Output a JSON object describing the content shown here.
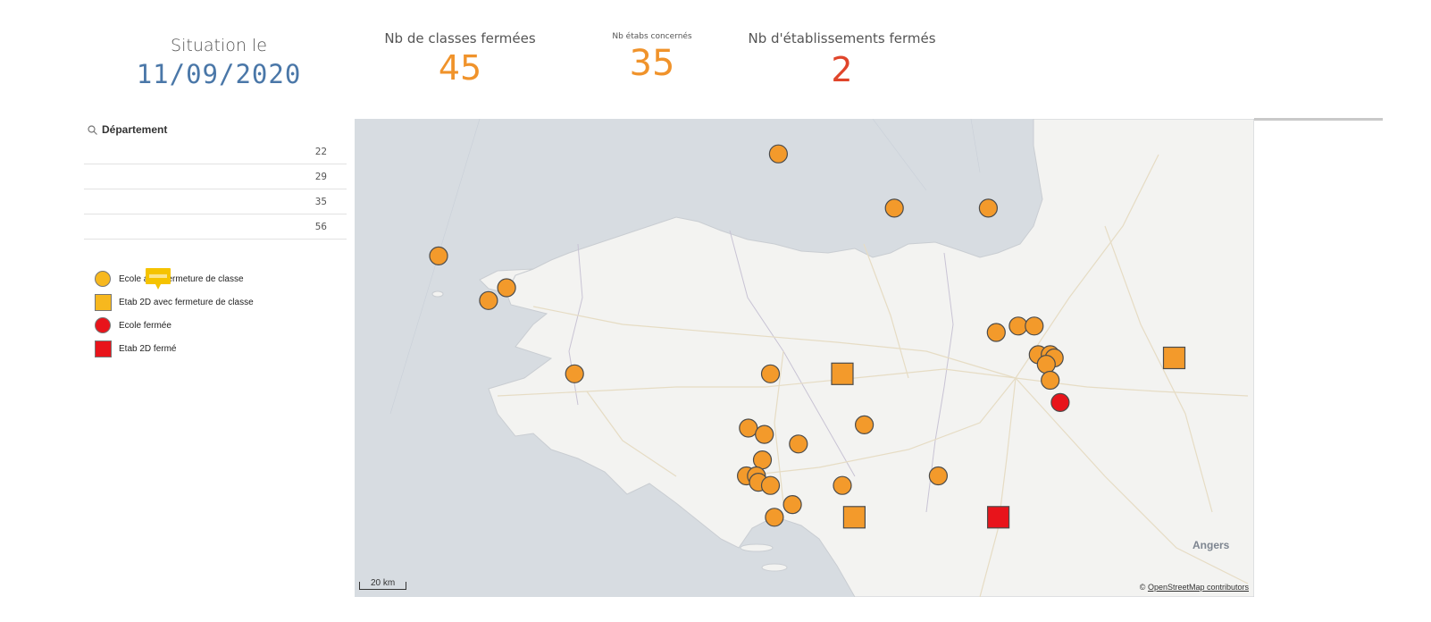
{
  "kpis": {
    "date": {
      "label": "Situation le",
      "value": "11/09/2020"
    },
    "classes": {
      "label": "Nb de classes fermées",
      "value": "45"
    },
    "etabs": {
      "label": "Nb étabs concernés",
      "value": "35"
    },
    "closed": {
      "label": "Nb d'établissements fermés",
      "value": "2"
    }
  },
  "filter": {
    "title": "Département",
    "icon": "search-icon",
    "rows": [
      "22",
      "29",
      "35",
      "56"
    ]
  },
  "legend": {
    "items": [
      {
        "label": "Ecole avec fermeture de classe",
        "shape": "circle",
        "color": "#f7b81e"
      },
      {
        "label": "Etab 2D avec fermeture de classe",
        "shape": "square",
        "color": "#f7b81e"
      },
      {
        "label": "Ecole fermée",
        "shape": "circle",
        "color": "#e8141b"
      },
      {
        "label": "Etab 2D fermé",
        "shape": "square",
        "color": "#e8141b"
      }
    ],
    "comment_icon": "comment-icon"
  },
  "map": {
    "scale_label": "20 km",
    "attribution_prefix": "© ",
    "attribution_link": "OpenStreetMap contributors",
    "city_labels": [
      "Angers"
    ],
    "marker_colors": {
      "orange": "#f39a2b",
      "red": "#e8141b",
      "stroke": "#4b4b4b"
    },
    "markers": [
      {
        "shape": "circle",
        "color": "orange",
        "lon": -3.08,
        "lat": 48.84
      },
      {
        "shape": "circle",
        "color": "orange",
        "lon": -4.78,
        "lat": 48.52
      },
      {
        "shape": "circle",
        "color": "orange",
        "lon": -4.53,
        "lat": 48.38
      },
      {
        "shape": "circle",
        "color": "orange",
        "lon": -4.44,
        "lat": 48.42
      },
      {
        "shape": "circle",
        "color": "orange",
        "lon": -2.5,
        "lat": 48.67
      },
      {
        "shape": "circle",
        "color": "orange",
        "lon": -2.03,
        "lat": 48.67
      },
      {
        "shape": "circle",
        "color": "orange",
        "lon": -1.99,
        "lat": 48.28
      },
      {
        "shape": "circle",
        "color": "orange",
        "lon": -1.88,
        "lat": 48.3
      },
      {
        "shape": "circle",
        "color": "orange",
        "lon": -1.8,
        "lat": 48.3
      },
      {
        "shape": "circle",
        "color": "orange",
        "lon": -1.78,
        "lat": 48.21
      },
      {
        "shape": "circle",
        "color": "orange",
        "lon": -1.72,
        "lat": 48.21
      },
      {
        "shape": "circle",
        "color": "orange",
        "lon": -1.7,
        "lat": 48.2
      },
      {
        "shape": "circle",
        "color": "orange",
        "lon": -1.74,
        "lat": 48.18
      },
      {
        "shape": "circle",
        "color": "orange",
        "lon": -1.72,
        "lat": 48.13
      },
      {
        "shape": "circle",
        "color": "red",
        "lon": -1.67,
        "lat": 48.06
      },
      {
        "shape": "circle",
        "color": "orange",
        "lon": -4.1,
        "lat": 48.15
      },
      {
        "shape": "circle",
        "color": "orange",
        "lon": -3.12,
        "lat": 48.15
      },
      {
        "shape": "circle",
        "color": "orange",
        "lon": -2.76,
        "lat": 48.15
      },
      {
        "shape": "circle",
        "color": "orange",
        "lon": -2.65,
        "lat": 47.99
      },
      {
        "shape": "circle",
        "color": "orange",
        "lon": -3.23,
        "lat": 47.98
      },
      {
        "shape": "circle",
        "color": "orange",
        "lon": -3.15,
        "lat": 47.96
      },
      {
        "shape": "circle",
        "color": "orange",
        "lon": -2.98,
        "lat": 47.93
      },
      {
        "shape": "circle",
        "color": "orange",
        "lon": -3.16,
        "lat": 47.88
      },
      {
        "shape": "circle",
        "color": "orange",
        "lon": -3.24,
        "lat": 47.83
      },
      {
        "shape": "circle",
        "color": "orange",
        "lon": -3.19,
        "lat": 47.83
      },
      {
        "shape": "circle",
        "color": "orange",
        "lon": -3.18,
        "lat": 47.81
      },
      {
        "shape": "circle",
        "color": "orange",
        "lon": -3.12,
        "lat": 47.8
      },
      {
        "shape": "circle",
        "color": "orange",
        "lon": -3.01,
        "lat": 47.74
      },
      {
        "shape": "circle",
        "color": "orange",
        "lon": -2.76,
        "lat": 47.8
      },
      {
        "shape": "circle",
        "color": "orange",
        "lon": -2.28,
        "lat": 47.83
      },
      {
        "shape": "circle",
        "color": "orange",
        "lon": -3.1,
        "lat": 47.7
      },
      {
        "shape": "square",
        "color": "orange",
        "lon": -2.76,
        "lat": 48.15
      },
      {
        "shape": "square",
        "color": "orange",
        "lon": -2.7,
        "lat": 47.7
      },
      {
        "shape": "square",
        "color": "orange",
        "lon": -1.1,
        "lat": 48.2
      },
      {
        "shape": "square",
        "color": "red",
        "lon": -1.98,
        "lat": 47.7
      }
    ]
  }
}
